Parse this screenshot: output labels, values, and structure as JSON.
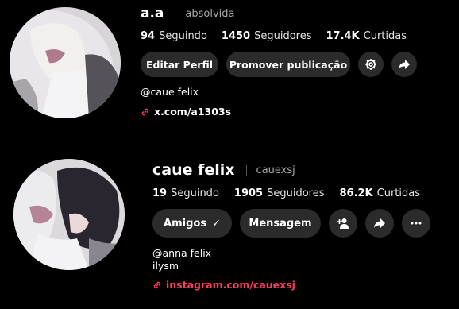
{
  "profiles": [
    {
      "display_name": "a.a",
      "handle": "absolvida",
      "stats": [
        {
          "value": "94",
          "label": "Seguindo"
        },
        {
          "value": "1450",
          "label": "Seguidores"
        },
        {
          "value": "17.4K",
          "label": "Curtidas"
        }
      ],
      "buttons": {
        "edit_profile": "Editar Perfil",
        "promote": "Promover publicação"
      },
      "bio_lines": [
        "@caue felix"
      ],
      "link": "x.com/a1303s",
      "icons": [
        "gear-icon",
        "share-icon",
        "link-icon"
      ]
    },
    {
      "display_name": "caue felix",
      "handle": "cauexsj",
      "stats": [
        {
          "value": "19",
          "label": "Seguindo"
        },
        {
          "value": "1905",
          "label": "Seguidores"
        },
        {
          "value": "86.2K",
          "label": "Curtidas"
        }
      ],
      "buttons": {
        "friends": "Amigos",
        "friends_check": "✓",
        "message": "Mensagem"
      },
      "bio_lines": [
        "@anna felix",
        "ilysm"
      ],
      "link": "instagram.com/cauexsj",
      "icons": [
        "add-friend-icon",
        "share-icon",
        "more-icon",
        "link-icon"
      ]
    }
  ],
  "colors": {
    "background": "#000000",
    "button_bg": "#2b2b2b",
    "secondary_text": "#a8a8a8",
    "link_accent": "#ff3b5c"
  }
}
